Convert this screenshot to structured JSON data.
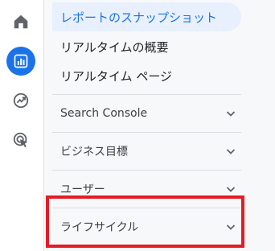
{
  "rail": {
    "items": [
      {
        "icon": "home-icon"
      },
      {
        "icon": "reports-icon",
        "active": true
      },
      {
        "icon": "explore-icon"
      },
      {
        "icon": "advertising-icon"
      }
    ]
  },
  "nav": {
    "items": [
      {
        "label": "レポートのスナップショット",
        "selected": true
      },
      {
        "label": "リアルタイムの概要"
      },
      {
        "label": "リアルタイム ページ"
      }
    ]
  },
  "sections": [
    {
      "label": "Search Console"
    },
    {
      "label": "ビジネス目標"
    },
    {
      "label": "ユーザー"
    },
    {
      "label": "ライフサイクル"
    }
  ],
  "colors": {
    "accent": "#1a73e8",
    "highlight": "#e21d26"
  }
}
